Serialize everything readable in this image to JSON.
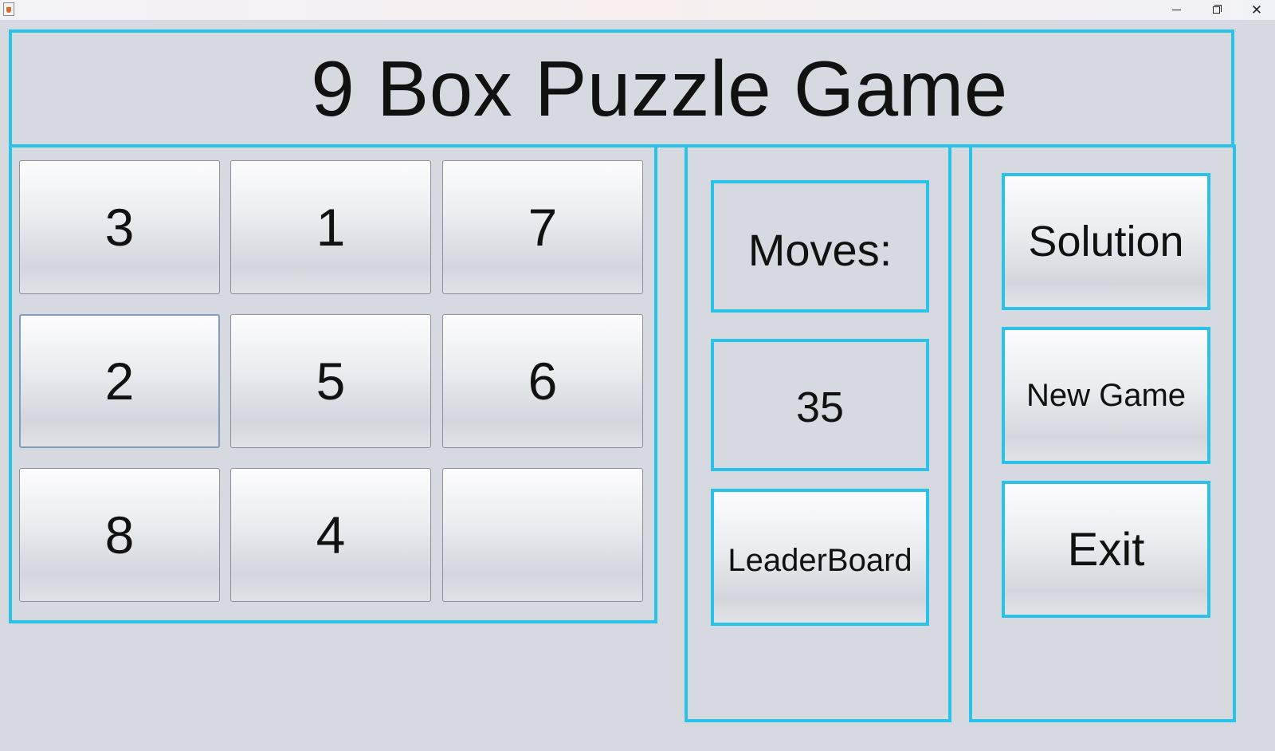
{
  "window": {
    "minimize_glyph": "",
    "close_glyph": "✕"
  },
  "title": "9 Box Puzzle Game",
  "board": {
    "tiles": [
      "3",
      "1",
      "7",
      "2",
      "5",
      "6",
      "8",
      "4",
      ""
    ]
  },
  "moves_panel": {
    "moves_label": "Moves:",
    "moves_count": "35",
    "leaderboard_label": "LeaderBoard"
  },
  "controls": {
    "solution_label": "Solution",
    "new_game_label": "New Game",
    "exit_label": "Exit"
  },
  "colors": {
    "accent_border": "#29c3ea",
    "background": "#d6d9e0"
  }
}
